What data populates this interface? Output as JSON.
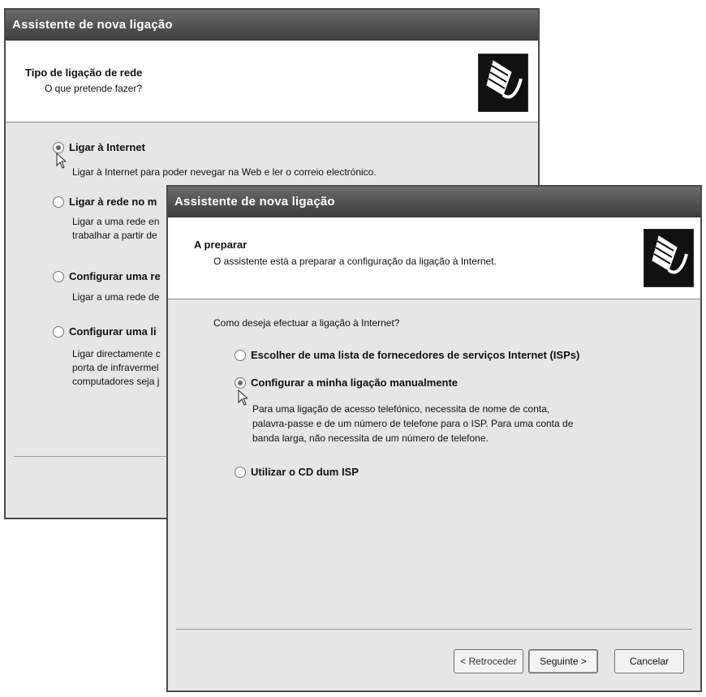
{
  "back_window": {
    "title": "Assistente de nova ligação",
    "header": {
      "title": "Tipo de ligação de rede",
      "subtitle": "O que pretende fazer?"
    },
    "options": [
      {
        "label": "Ligar à Internet",
        "checked": true,
        "description": "Ligar à Internet para poder nevegar na Web e ler o correio electrónico."
      },
      {
        "label": "Ligar à rede no m",
        "checked": false,
        "description_lines": [
          "Ligar a uma rede en",
          "trabalhar a partir de"
        ]
      },
      {
        "label": "Configurar uma re",
        "checked": false,
        "description_lines": [
          "Ligar a uma rede de"
        ]
      },
      {
        "label": "Configurar uma li",
        "checked": false,
        "description_lines": [
          "Ligar directamente c",
          "porta de infravermel",
          "computadores seja j"
        ]
      }
    ]
  },
  "front_window": {
    "title": "Assistente de nova ligação",
    "header": {
      "title": "A preparar",
      "subtitle": "O assistente está a preparar a configuração da ligação à Internet."
    },
    "question": "Como deseja efectuar a ligação à Internet?",
    "options": [
      {
        "label": "Escolher de uma lista de fornecedores de serviços Internet (ISPs)",
        "checked": false
      },
      {
        "label": "Configurar a minha ligação manualmente",
        "checked": true
      },
      {
        "label": "Utilizar o CD dum ISP",
        "checked": false
      }
    ],
    "manual_description_lines": [
      "Para uma ligação de acesso telefónico, necessita de nome de conta,",
      "palavra-passe e de um número de telefone para o ISP. Para uma conta de",
      "banda larga, não necessita de um número de telefone."
    ],
    "buttons": {
      "back": "< Retroceder",
      "next": "Seguinte >",
      "cancel": "Cancelar"
    }
  },
  "icons": [
    "network-cable-icon",
    "mouse-cursor-icon"
  ]
}
